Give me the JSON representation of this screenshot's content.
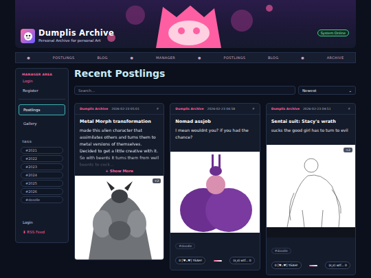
{
  "site": {
    "title": "Dumplis Archive",
    "subtitle": "Personal Archive for personal Art",
    "status": "System Online"
  },
  "nav": [
    "●",
    "POSTLINGS",
    "BLOG",
    "●",
    "MANAGER",
    "●",
    "POSTLINGS",
    "BLOG",
    "●",
    "ARCHIVE"
  ],
  "sidebar": {
    "heading": "MANAGER AREA",
    "manager_items": [
      {
        "label": "Login",
        "kind": "accent"
      },
      {
        "label": "Register",
        "kind": "plain"
      }
    ],
    "items": [
      {
        "label": "Postlings",
        "selected": true
      },
      {
        "label": "Gallery",
        "selected": false
      }
    ],
    "tags_heading": "TAGS",
    "tags": [
      "#2021",
      "#2022",
      "#2023",
      "#2024",
      "#2025",
      "#2026",
      "#doodle"
    ],
    "footer_items": [
      {
        "label": "Login",
        "kind": "plain"
      },
      {
        "label": "⬇ RSS Feed",
        "kind": "accent"
      }
    ]
  },
  "main": {
    "title": "Recent Postlings",
    "search": {
      "placeholder": "Search..."
    },
    "sort": "Newest",
    "sort_arrow": "⌄"
  },
  "posts": [
    {
      "author": "Dumplis Archive",
      "date": "2026-02-23 05:01",
      "hash": "#",
      "title": "Metal Morph transformation",
      "body": [
        "made this alien character that assimilates others and turns them to metal versions of themselves.",
        "Decided to get a little creative with it. So with beents it turns them from well beents to cock..."
      ],
      "show_more": "+ Show More",
      "image": {
        "kind": "metal",
        "extra": "+2"
      },
      "tags": [],
      "reactions": []
    },
    {
      "author": "Dumplis Archive",
      "date": "2026-02-23 04:58",
      "hash": "#",
      "title": "Nomad assjob",
      "body": [
        "I mean wouldnt you? if you had the chance?"
      ],
      "show_more": "",
      "image": {
        "kind": "purple",
        "extra": ""
      },
      "tags": [
        "#doodle"
      ],
      "reactions": [
        "0 [♥ᴗ♥] YEAH!",
        "(ಠ_ಠ) wtf... 0"
      ]
    },
    {
      "author": "Dumplis Archive",
      "date": "2026-02-23 04:51",
      "hash": "#",
      "title": "Sentai suit: Stacy's wrath",
      "body": [
        "sucks the good girl has to turn to evil"
      ],
      "show_more": "",
      "image": {
        "kind": "sketch",
        "extra": "+2"
      },
      "tags": [
        "#doodle"
      ],
      "reactions": [
        "0 [♥ᴗ♥] YEAH!",
        "(ಠ_ಠ) wtf... 0"
      ]
    }
  ]
}
